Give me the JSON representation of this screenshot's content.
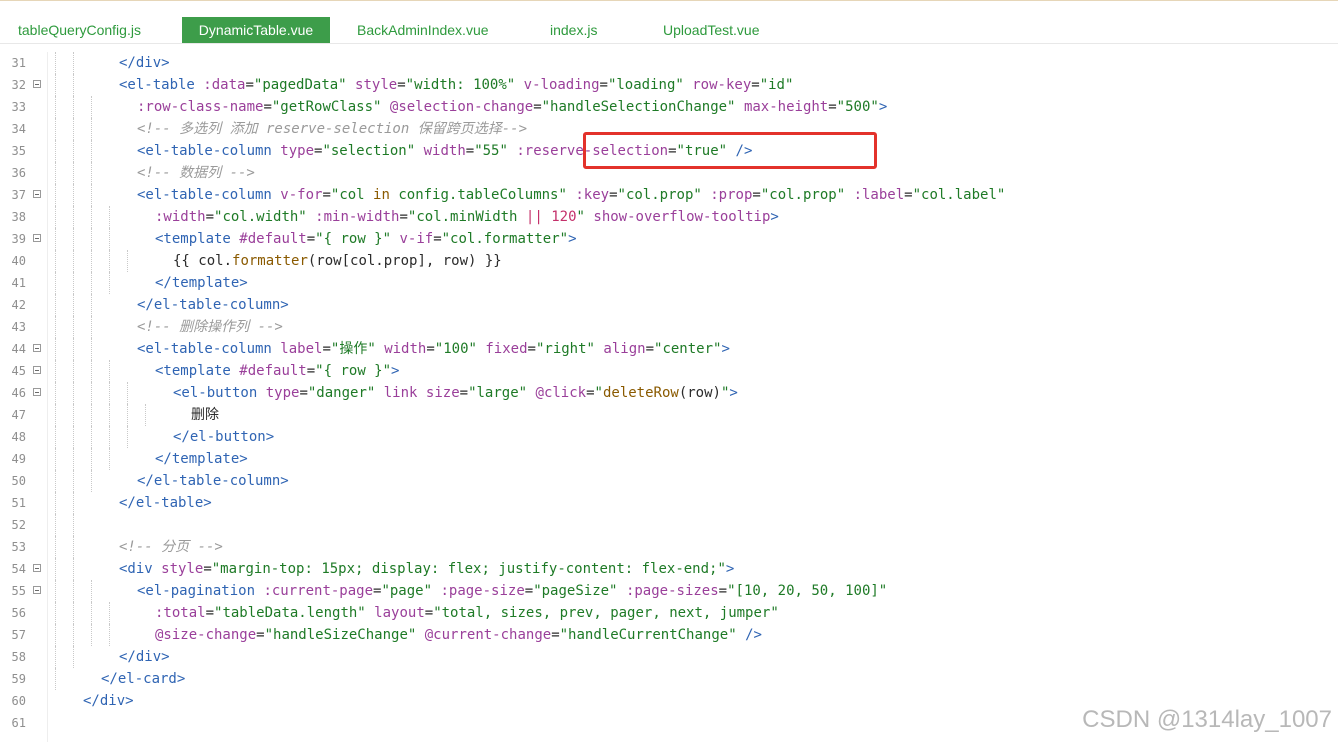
{
  "tabs": [
    {
      "label": "tableQueryConfig.js",
      "active": false
    },
    {
      "label": "DynamicTable.vue",
      "active": true
    },
    {
      "label": "BackAdminIndex.vue",
      "active": false
    },
    {
      "label": "index.js",
      "active": false
    },
    {
      "label": "UploadTest.vue",
      "active": false
    }
  ],
  "editor": {
    "lines": [
      {
        "n": "31",
        "fold": false,
        "indent": 4,
        "tokens": [
          [
            "tag",
            "</div>"
          ]
        ]
      },
      {
        "n": "32",
        "fold": true,
        "indent": 4,
        "tokens": [
          [
            "tag",
            "<el-table "
          ],
          [
            "attr",
            ":data"
          ],
          [
            "plain",
            "="
          ],
          [
            "str",
            "\"pagedData\""
          ],
          [
            "plain",
            " "
          ],
          [
            "attr",
            "style"
          ],
          [
            "plain",
            "="
          ],
          [
            "str",
            "\"width: 100%\""
          ],
          [
            "plain",
            " "
          ],
          [
            "attr",
            "v-loading"
          ],
          [
            "plain",
            "="
          ],
          [
            "str",
            "\"loading\""
          ],
          [
            "plain",
            " "
          ],
          [
            "attr",
            "row-key"
          ],
          [
            "plain",
            "="
          ],
          [
            "str",
            "\"id\""
          ]
        ]
      },
      {
        "n": "33",
        "fold": false,
        "indent": 6,
        "tokens": [
          [
            "attr",
            ":row-class-name"
          ],
          [
            "plain",
            "="
          ],
          [
            "str",
            "\"getRowClass\""
          ],
          [
            "plain",
            " "
          ],
          [
            "attr",
            "@selection-change"
          ],
          [
            "plain",
            "="
          ],
          [
            "str",
            "\"handleSelectionChange\""
          ],
          [
            "plain",
            " "
          ],
          [
            "attr",
            "max-height"
          ],
          [
            "plain",
            "="
          ],
          [
            "str",
            "\"500\""
          ],
          [
            "tag",
            ">"
          ]
        ]
      },
      {
        "n": "34",
        "fold": false,
        "indent": 6,
        "tokens": [
          [
            "com",
            "<!-- 多选列 添加 reserve-selection 保留跨页选择-->"
          ]
        ]
      },
      {
        "n": "35",
        "fold": false,
        "indent": 6,
        "tokens": [
          [
            "tag",
            "<el-table-column "
          ],
          [
            "attr",
            "type"
          ],
          [
            "plain",
            "="
          ],
          [
            "str",
            "\"selection\""
          ],
          [
            "plain",
            " "
          ],
          [
            "attr",
            "width"
          ],
          [
            "plain",
            "="
          ],
          [
            "str",
            "\"55\""
          ],
          [
            "plain",
            " "
          ],
          [
            "attr",
            ":reserve-selection"
          ],
          [
            "plain",
            "="
          ],
          [
            "str",
            "\"true\""
          ],
          [
            "plain",
            " "
          ],
          [
            "tag",
            "/>"
          ]
        ]
      },
      {
        "n": "36",
        "fold": false,
        "indent": 6,
        "tokens": [
          [
            "com",
            "<!-- 数据列 -->"
          ]
        ]
      },
      {
        "n": "37",
        "fold": true,
        "indent": 6,
        "tokens": [
          [
            "tag",
            "<el-table-column "
          ],
          [
            "attr",
            "v-for"
          ],
          [
            "plain",
            "="
          ],
          [
            "str",
            "\"col "
          ],
          [
            "kw",
            "in"
          ],
          [
            "str",
            " config.tableColumns\""
          ],
          [
            "plain",
            " "
          ],
          [
            "attr",
            ":key"
          ],
          [
            "plain",
            "="
          ],
          [
            "str",
            "\"col.prop\""
          ],
          [
            "plain",
            " "
          ],
          [
            "attr",
            ":prop"
          ],
          [
            "plain",
            "="
          ],
          [
            "str",
            "\"col.prop\""
          ],
          [
            "plain",
            " "
          ],
          [
            "attr",
            ":label"
          ],
          [
            "plain",
            "="
          ],
          [
            "str",
            "\"col.label\""
          ]
        ]
      },
      {
        "n": "38",
        "fold": false,
        "indent": 8,
        "tokens": [
          [
            "attr",
            ":width"
          ],
          [
            "plain",
            "="
          ],
          [
            "str",
            "\"col.width\""
          ],
          [
            "plain",
            " "
          ],
          [
            "attr",
            ":min-width"
          ],
          [
            "plain",
            "="
          ],
          [
            "str",
            "\"col.minWidth "
          ],
          [
            "num",
            "||"
          ],
          [
            "str",
            " "
          ],
          [
            "num",
            "120"
          ],
          [
            "str",
            "\""
          ],
          [
            "plain",
            " "
          ],
          [
            "attr",
            "show-overflow-tooltip"
          ],
          [
            "tag",
            ">"
          ]
        ]
      },
      {
        "n": "39",
        "fold": true,
        "indent": 8,
        "tokens": [
          [
            "tag",
            "<template "
          ],
          [
            "attr",
            "#default"
          ],
          [
            "plain",
            "="
          ],
          [
            "str",
            "\"{ row }\""
          ],
          [
            "plain",
            " "
          ],
          [
            "attr",
            "v-if"
          ],
          [
            "plain",
            "="
          ],
          [
            "str",
            "\"col.formatter\""
          ],
          [
            "tag",
            ">"
          ]
        ]
      },
      {
        "n": "40",
        "fold": false,
        "indent": 10,
        "tokens": [
          [
            "plain",
            "{{ col."
          ],
          [
            "fn",
            "formatter"
          ],
          [
            "plain",
            "(row[col.prop], row) }}"
          ]
        ]
      },
      {
        "n": "41",
        "fold": false,
        "indent": 8,
        "tokens": [
          [
            "tag",
            "</template>"
          ]
        ]
      },
      {
        "n": "42",
        "fold": false,
        "indent": 6,
        "tokens": [
          [
            "tag",
            "</el-table-column>"
          ]
        ]
      },
      {
        "n": "43",
        "fold": false,
        "indent": 6,
        "tokens": [
          [
            "com",
            "<!-- 删除操作列 -->"
          ]
        ]
      },
      {
        "n": "44",
        "fold": true,
        "indent": 6,
        "tokens": [
          [
            "tag",
            "<el-table-column "
          ],
          [
            "attr",
            "label"
          ],
          [
            "plain",
            "="
          ],
          [
            "str",
            "\"操作\""
          ],
          [
            "plain",
            " "
          ],
          [
            "attr",
            "width"
          ],
          [
            "plain",
            "="
          ],
          [
            "str",
            "\"100\""
          ],
          [
            "plain",
            " "
          ],
          [
            "attr",
            "fixed"
          ],
          [
            "plain",
            "="
          ],
          [
            "str",
            "\"right\""
          ],
          [
            "plain",
            " "
          ],
          [
            "attr",
            "align"
          ],
          [
            "plain",
            "="
          ],
          [
            "str",
            "\"center\""
          ],
          [
            "tag",
            ">"
          ]
        ]
      },
      {
        "n": "45",
        "fold": true,
        "indent": 8,
        "tokens": [
          [
            "tag",
            "<template "
          ],
          [
            "attr",
            "#default"
          ],
          [
            "plain",
            "="
          ],
          [
            "str",
            "\"{ row }\""
          ],
          [
            "tag",
            ">"
          ]
        ]
      },
      {
        "n": "46",
        "fold": true,
        "indent": 10,
        "tokens": [
          [
            "tag",
            "<el-button "
          ],
          [
            "attr",
            "type"
          ],
          [
            "plain",
            "="
          ],
          [
            "str",
            "\"danger\""
          ],
          [
            "plain",
            " "
          ],
          [
            "attr",
            "link"
          ],
          [
            "plain",
            " "
          ],
          [
            "attr",
            "size"
          ],
          [
            "plain",
            "="
          ],
          [
            "str",
            "\"large\""
          ],
          [
            "plain",
            " "
          ],
          [
            "attr",
            "@click"
          ],
          [
            "plain",
            "="
          ],
          [
            "str",
            "\""
          ],
          [
            "fn",
            "deleteRow"
          ],
          [
            "plain",
            "(row)"
          ],
          [
            "str",
            "\""
          ],
          [
            "tag",
            ">"
          ]
        ]
      },
      {
        "n": "47",
        "fold": false,
        "indent": 12,
        "tokens": [
          [
            "zh",
            "删除"
          ]
        ]
      },
      {
        "n": "48",
        "fold": false,
        "indent": 10,
        "tokens": [
          [
            "tag",
            "</el-button>"
          ]
        ]
      },
      {
        "n": "49",
        "fold": false,
        "indent": 8,
        "tokens": [
          [
            "tag",
            "</template>"
          ]
        ]
      },
      {
        "n": "50",
        "fold": false,
        "indent": 6,
        "tokens": [
          [
            "tag",
            "</el-table-column>"
          ]
        ]
      },
      {
        "n": "51",
        "fold": false,
        "indent": 4,
        "tokens": [
          [
            "tag",
            "</el-table>"
          ]
        ]
      },
      {
        "n": "52",
        "fold": false,
        "indent": 4,
        "tokens": []
      },
      {
        "n": "53",
        "fold": false,
        "indent": 4,
        "tokens": [
          [
            "com",
            "<!-- 分页 -->"
          ]
        ]
      },
      {
        "n": "54",
        "fold": true,
        "indent": 4,
        "tokens": [
          [
            "tag",
            "<div "
          ],
          [
            "attr",
            "style"
          ],
          [
            "plain",
            "="
          ],
          [
            "str",
            "\"margin-top: 15px; display: flex; justify-content: flex-end;\""
          ],
          [
            "tag",
            ">"
          ]
        ]
      },
      {
        "n": "55",
        "fold": true,
        "indent": 6,
        "tokens": [
          [
            "tag",
            "<el-pagination "
          ],
          [
            "attr",
            ":current-page"
          ],
          [
            "plain",
            "="
          ],
          [
            "str",
            "\"page\""
          ],
          [
            "plain",
            " "
          ],
          [
            "attr",
            ":page-size"
          ],
          [
            "plain",
            "="
          ],
          [
            "str",
            "\"pageSize\""
          ],
          [
            "plain",
            " "
          ],
          [
            "attr",
            ":page-sizes"
          ],
          [
            "plain",
            "="
          ],
          [
            "str",
            "\"[10, 20, 50, 100]\""
          ]
        ]
      },
      {
        "n": "56",
        "fold": false,
        "indent": 8,
        "tokens": [
          [
            "attr",
            ":total"
          ],
          [
            "plain",
            "="
          ],
          [
            "str",
            "\"tableData.length\""
          ],
          [
            "plain",
            " "
          ],
          [
            "attr",
            "layout"
          ],
          [
            "plain",
            "="
          ],
          [
            "str",
            "\"total, sizes, prev, pager, next, jumper\""
          ]
        ]
      },
      {
        "n": "57",
        "fold": false,
        "indent": 8,
        "tokens": [
          [
            "attr",
            "@size-change"
          ],
          [
            "plain",
            "="
          ],
          [
            "str",
            "\"handleSizeChange\""
          ],
          [
            "plain",
            " "
          ],
          [
            "attr",
            "@current-change"
          ],
          [
            "plain",
            "="
          ],
          [
            "str",
            "\"handleCurrentChange\""
          ],
          [
            "plain",
            " "
          ],
          [
            "tag",
            "/>"
          ]
        ]
      },
      {
        "n": "58",
        "fold": false,
        "indent": 4,
        "tokens": [
          [
            "tag",
            "</div>"
          ]
        ]
      },
      {
        "n": "59",
        "fold": false,
        "indent": 2,
        "tokens": [
          [
            "tag",
            "</el-card>"
          ]
        ]
      },
      {
        "n": "60",
        "fold": false,
        "indent": 0,
        "tokens": [
          [
            "tag",
            "</div>"
          ]
        ]
      },
      {
        "n": "61",
        "fold": false,
        "indent": 0,
        "tokens": []
      }
    ]
  },
  "watermark": "CSDN @1314lay_1007"
}
